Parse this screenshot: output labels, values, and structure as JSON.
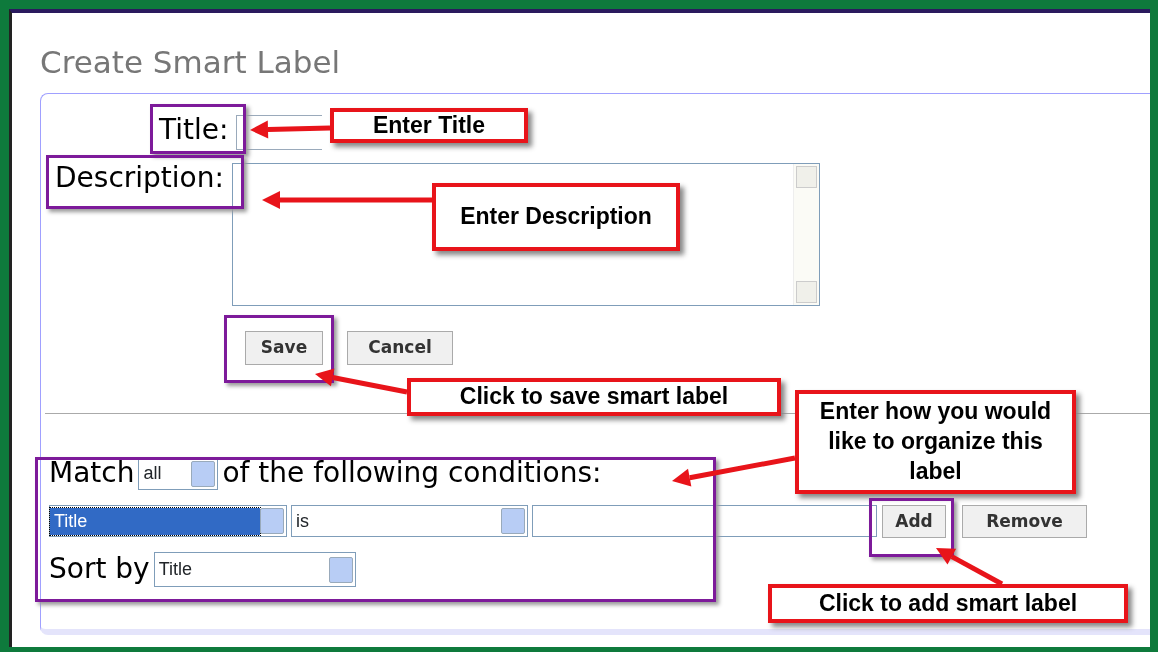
{
  "heading": "Create Smart Label",
  "form": {
    "title_label": "Title:",
    "description_label": "Description:",
    "buttons": [
      "Save",
      "Cancel"
    ]
  },
  "conditions": {
    "match_label": "Match",
    "match_value": "all",
    "match_suffix": "of the following conditions:",
    "field_value": "Title",
    "field_focused": true,
    "operator_value": "is",
    "buttons": [
      "Add",
      "Remove"
    ],
    "sort_label": "Sort by",
    "sort_value": "Title"
  },
  "callouts": [
    {
      "text": "Enter Title"
    },
    {
      "text": "Enter Description"
    },
    {
      "text": "Click to save smart label"
    },
    {
      "text": "Enter how you would like to organize this label"
    },
    {
      "text": "Click to add smart label"
    }
  ]
}
